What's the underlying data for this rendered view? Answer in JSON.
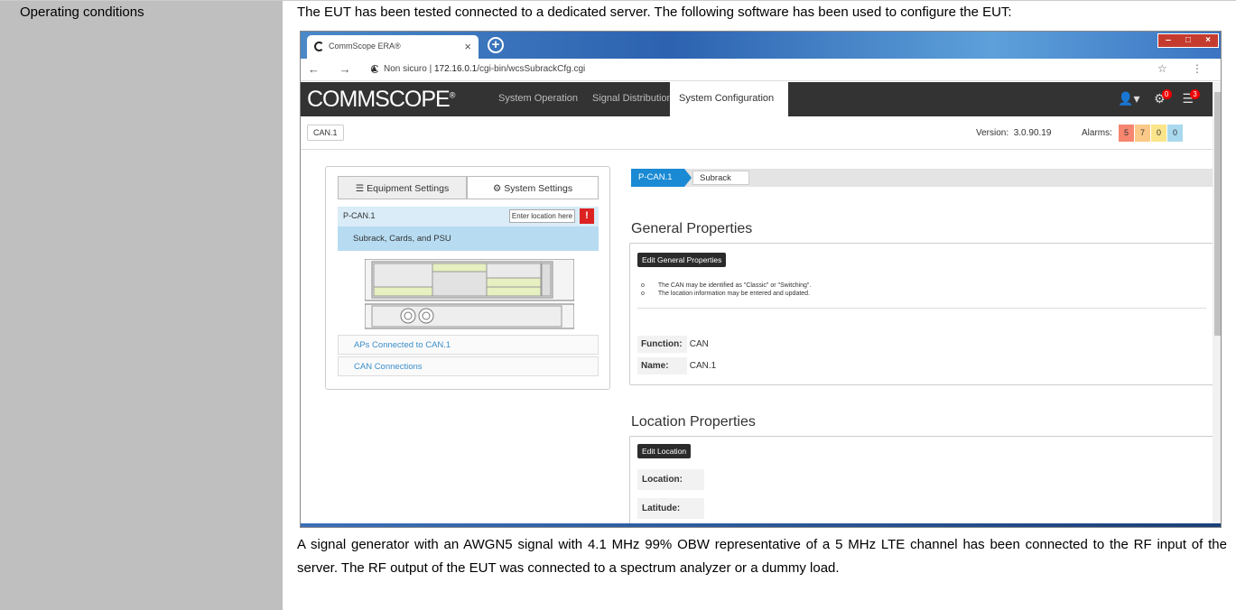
{
  "label": "Operating conditions",
  "intro": "The EUT has been tested connected to a dedicated server. The following software has been used to configure the EUT:",
  "paragraph": "A signal generator with an AWGN5 signal with 4.1 MHz 99% OBW representative of a 5 MHz LTE channel has been connected to the RF input of the server. The RF output of the EUT was connected to a spectrum analyzer or a dummy load.",
  "browser": {
    "tab_title": "CommScope ERA®",
    "tab_close": "×",
    "new_tab": "+",
    "security": "Non sicuro",
    "url_host": "172.16.0.1",
    "url_path": "/cgi-bin/wcsSubrackCfg.cgi",
    "nav_icons": "← → C",
    "right_icons": "☆ ⋮"
  },
  "app": {
    "logo": "COMMSCOPE",
    "logo_mark": "®",
    "nav": [
      "System Operation",
      "Signal Distribution",
      "System Configuration"
    ],
    "active_nav": "System Configuration",
    "badge_gear": "0",
    "badge_list": "3",
    "can_button": "CAN.1",
    "version_label": "Version:",
    "version": "3.0.90.19",
    "alarms_label": "Alarms:",
    "alarm_counts": [
      "5",
      "7",
      "0",
      "0"
    ],
    "alarm_colors": [
      "#f6866f",
      "#fbc987",
      "#fbe58a",
      "#a9d9ee"
    ]
  },
  "left": {
    "tab_equipment": "Equipment Settings",
    "tab_system": "System Settings",
    "pcan": "P-CAN.1",
    "enter_location": "Enter location here",
    "alert": "!",
    "subrack": "Subrack, Cards, and PSU",
    "aps": "APs Connected to CAN.1",
    "connections": "CAN Connections"
  },
  "right": {
    "crumb1": "P-CAN.1",
    "crumb2": "Subrack",
    "general_title": "General Properties",
    "edit_general": "Edit General Properties",
    "bullet1": "The CAN may be identified as \"Classic\" or \"Switching\".",
    "bullet2": "The location information may be entered and updated.",
    "function_label": "Function:",
    "function_value": "CAN",
    "name_label": "Name:",
    "name_value": "CAN.1",
    "location_title": "Location Properties",
    "edit_location": "Edit Location",
    "location_label": "Location:",
    "latitude_label": "Latitude:"
  }
}
